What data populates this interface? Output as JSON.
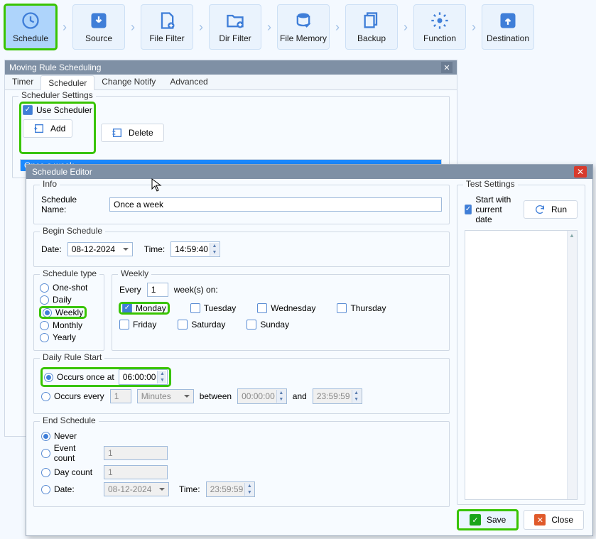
{
  "toolbar": {
    "items": [
      {
        "label": "Schedule"
      },
      {
        "label": "Source"
      },
      {
        "label": "File Filter"
      },
      {
        "label": "Dir Filter"
      },
      {
        "label": "File Memory"
      },
      {
        "label": "Backup"
      },
      {
        "label": "Function"
      },
      {
        "label": "Destination"
      }
    ]
  },
  "dialog1": {
    "title": "Moving Rule Scheduling",
    "tabs": {
      "timer": "Timer",
      "scheduler": "Scheduler",
      "change": "Change Notify",
      "advanced": "Advanced"
    },
    "settings_legend": "Scheduler Settings",
    "use_scheduler": "Use Scheduler",
    "add": "Add",
    "delete": "Delete",
    "listitem": "Once a week"
  },
  "dialog2": {
    "title": "Schedule Editor",
    "info": {
      "legend": "Info",
      "name_label": "Schedule Name:",
      "name_value": "Once a week"
    },
    "begin": {
      "legend": "Begin Schedule",
      "date_label": "Date:",
      "date_value": "08-12-2024",
      "time_label": "Time:",
      "time_value": "14:59:40"
    },
    "stype": {
      "legend": "Schedule type",
      "oneshot": "One-shot",
      "daily": "Daily",
      "weekly": "Weekly",
      "monthly": "Monthly",
      "yearly": "Yearly"
    },
    "weekly": {
      "legend": "Weekly",
      "every_label": "Every",
      "every_value": "1",
      "weeks_on": "week(s) on:",
      "mon": "Monday",
      "tue": "Tuesday",
      "wed": "Wednesday",
      "thu": "Thursday",
      "fri": "Friday",
      "sat": "Saturday",
      "sun": "Sunday"
    },
    "daily_rule": {
      "legend": "Daily Rule Start",
      "occurs_once": "Occurs once at",
      "occurs_once_val": "06:00:00",
      "occurs_every": "Occurs every",
      "occurs_every_val": "1",
      "occurs_every_unit": "Minutes",
      "between": "between",
      "between_start": "00:00:00",
      "and": "and",
      "between_end": "23:59:59"
    },
    "end": {
      "legend": "End Schedule",
      "never": "Never",
      "event_count": "Event count",
      "event_count_val": "1",
      "day_count": "Day count",
      "day_count_val": "1",
      "date": "Date:",
      "date_val": "08-12-2024",
      "time": "Time:",
      "time_val": "23:59:59"
    },
    "test": {
      "legend": "Test Settings",
      "start_current": "Start with current date",
      "run": "Run"
    },
    "save": "Save",
    "close": "Close"
  }
}
